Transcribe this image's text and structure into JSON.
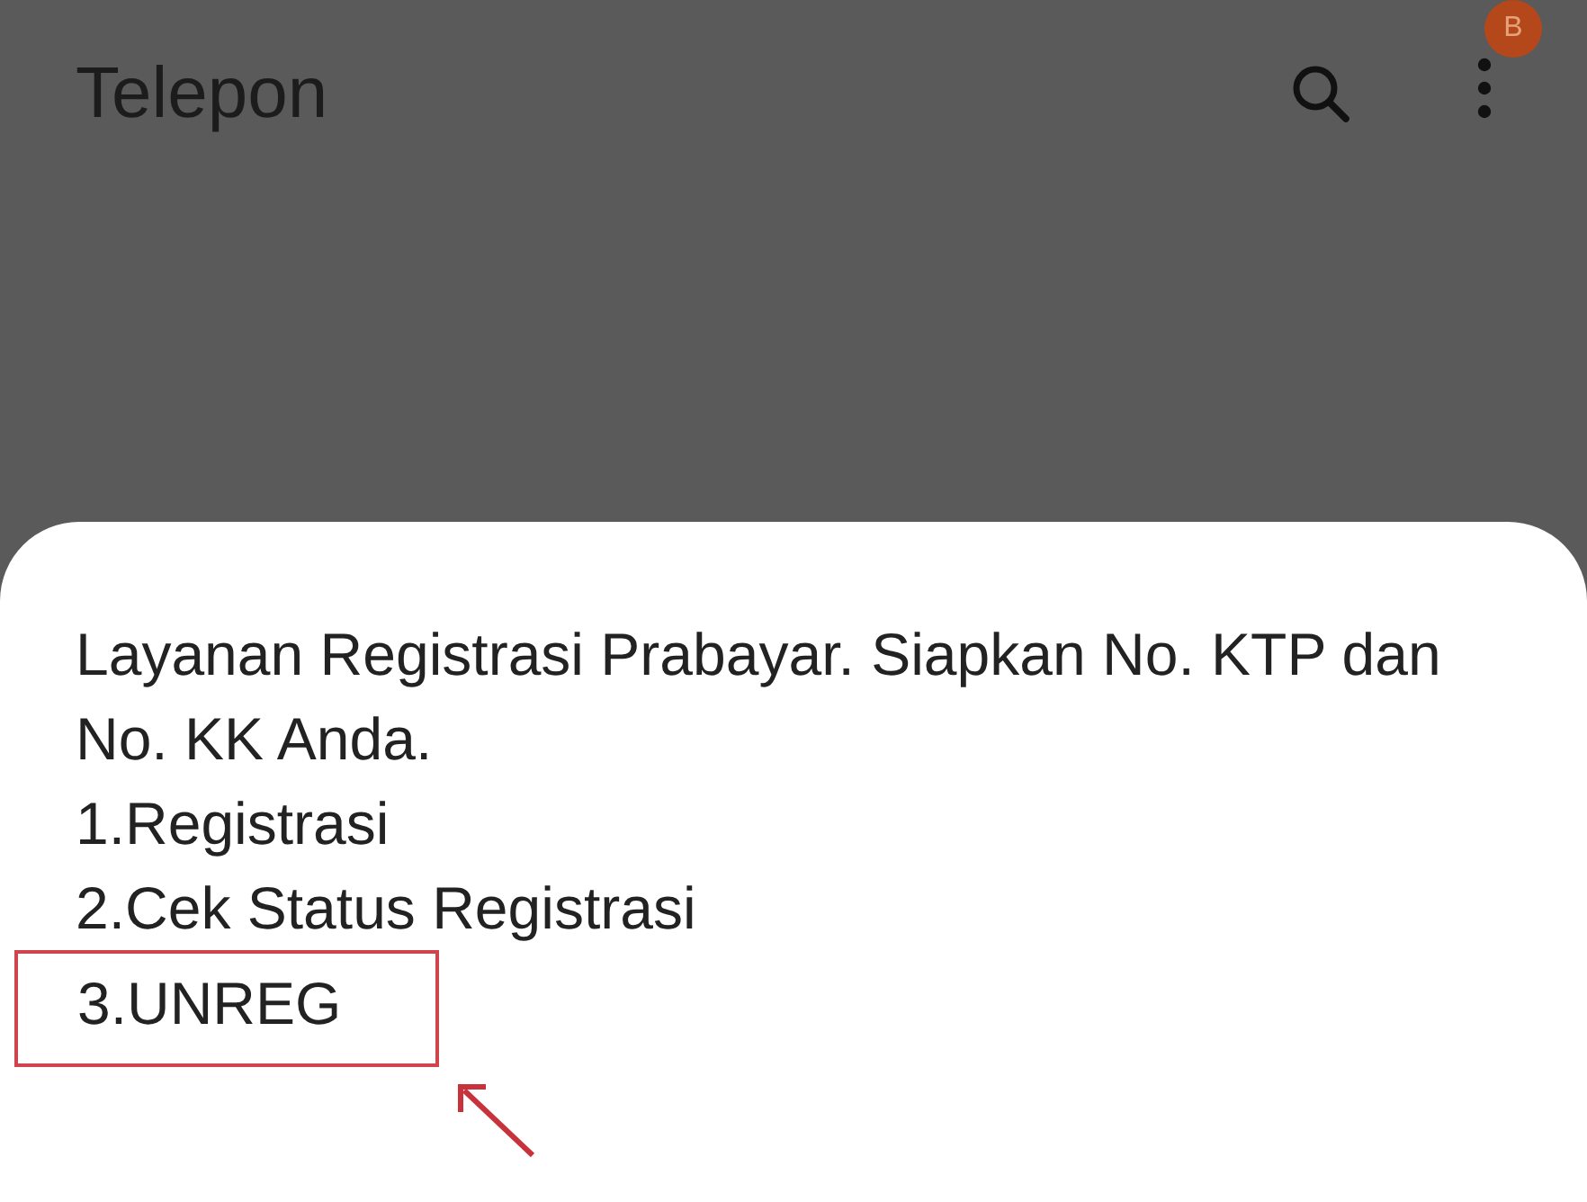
{
  "app_bar": {
    "title": "Telepon",
    "badge": "B"
  },
  "dialog": {
    "message": "Layanan Registrasi Prabayar. Siapkan No. KTP dan No. KK Anda.",
    "options": [
      {
        "text": "1.Registrasi",
        "highlighted": false
      },
      {
        "text": "2.Cek Status Registrasi",
        "highlighted": false
      },
      {
        "text": "3.UNREG",
        "highlighted": true
      }
    ]
  }
}
